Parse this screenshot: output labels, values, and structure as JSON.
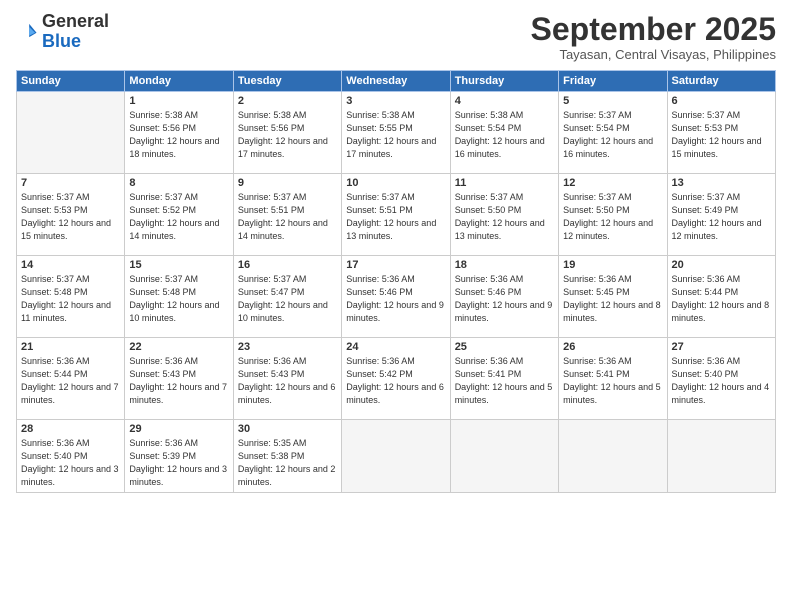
{
  "header": {
    "logo_general": "General",
    "logo_blue": "Blue",
    "month_title": "September 2025",
    "location": "Tayasan, Central Visayas, Philippines"
  },
  "days_of_week": [
    "Sunday",
    "Monday",
    "Tuesday",
    "Wednesday",
    "Thursday",
    "Friday",
    "Saturday"
  ],
  "weeks": [
    [
      {
        "day": "",
        "empty": true
      },
      {
        "day": "1",
        "sunrise": "5:38 AM",
        "sunset": "5:56 PM",
        "daylight": "12 hours and 18 minutes."
      },
      {
        "day": "2",
        "sunrise": "5:38 AM",
        "sunset": "5:56 PM",
        "daylight": "12 hours and 17 minutes."
      },
      {
        "day": "3",
        "sunrise": "5:38 AM",
        "sunset": "5:55 PM",
        "daylight": "12 hours and 17 minutes."
      },
      {
        "day": "4",
        "sunrise": "5:38 AM",
        "sunset": "5:54 PM",
        "daylight": "12 hours and 16 minutes."
      },
      {
        "day": "5",
        "sunrise": "5:37 AM",
        "sunset": "5:54 PM",
        "daylight": "12 hours and 16 minutes."
      },
      {
        "day": "6",
        "sunrise": "5:37 AM",
        "sunset": "5:53 PM",
        "daylight": "12 hours and 15 minutes."
      }
    ],
    [
      {
        "day": "7",
        "sunrise": "5:37 AM",
        "sunset": "5:53 PM",
        "daylight": "12 hours and 15 minutes."
      },
      {
        "day": "8",
        "sunrise": "5:37 AM",
        "sunset": "5:52 PM",
        "daylight": "12 hours and 14 minutes."
      },
      {
        "day": "9",
        "sunrise": "5:37 AM",
        "sunset": "5:51 PM",
        "daylight": "12 hours and 14 minutes."
      },
      {
        "day": "10",
        "sunrise": "5:37 AM",
        "sunset": "5:51 PM",
        "daylight": "12 hours and 13 minutes."
      },
      {
        "day": "11",
        "sunrise": "5:37 AM",
        "sunset": "5:50 PM",
        "daylight": "12 hours and 13 minutes."
      },
      {
        "day": "12",
        "sunrise": "5:37 AM",
        "sunset": "5:50 PM",
        "daylight": "12 hours and 12 minutes."
      },
      {
        "day": "13",
        "sunrise": "5:37 AM",
        "sunset": "5:49 PM",
        "daylight": "12 hours and 12 minutes."
      }
    ],
    [
      {
        "day": "14",
        "sunrise": "5:37 AM",
        "sunset": "5:48 PM",
        "daylight": "12 hours and 11 minutes."
      },
      {
        "day": "15",
        "sunrise": "5:37 AM",
        "sunset": "5:48 PM",
        "daylight": "12 hours and 10 minutes."
      },
      {
        "day": "16",
        "sunrise": "5:37 AM",
        "sunset": "5:47 PM",
        "daylight": "12 hours and 10 minutes."
      },
      {
        "day": "17",
        "sunrise": "5:36 AM",
        "sunset": "5:46 PM",
        "daylight": "12 hours and 9 minutes."
      },
      {
        "day": "18",
        "sunrise": "5:36 AM",
        "sunset": "5:46 PM",
        "daylight": "12 hours and 9 minutes."
      },
      {
        "day": "19",
        "sunrise": "5:36 AM",
        "sunset": "5:45 PM",
        "daylight": "12 hours and 8 minutes."
      },
      {
        "day": "20",
        "sunrise": "5:36 AM",
        "sunset": "5:44 PM",
        "daylight": "12 hours and 8 minutes."
      }
    ],
    [
      {
        "day": "21",
        "sunrise": "5:36 AM",
        "sunset": "5:44 PM",
        "daylight": "12 hours and 7 minutes."
      },
      {
        "day": "22",
        "sunrise": "5:36 AM",
        "sunset": "5:43 PM",
        "daylight": "12 hours and 7 minutes."
      },
      {
        "day": "23",
        "sunrise": "5:36 AM",
        "sunset": "5:43 PM",
        "daylight": "12 hours and 6 minutes."
      },
      {
        "day": "24",
        "sunrise": "5:36 AM",
        "sunset": "5:42 PM",
        "daylight": "12 hours and 6 minutes."
      },
      {
        "day": "25",
        "sunrise": "5:36 AM",
        "sunset": "5:41 PM",
        "daylight": "12 hours and 5 minutes."
      },
      {
        "day": "26",
        "sunrise": "5:36 AM",
        "sunset": "5:41 PM",
        "daylight": "12 hours and 5 minutes."
      },
      {
        "day": "27",
        "sunrise": "5:36 AM",
        "sunset": "5:40 PM",
        "daylight": "12 hours and 4 minutes."
      }
    ],
    [
      {
        "day": "28",
        "sunrise": "5:36 AM",
        "sunset": "5:40 PM",
        "daylight": "12 hours and 3 minutes."
      },
      {
        "day": "29",
        "sunrise": "5:36 AM",
        "sunset": "5:39 PM",
        "daylight": "12 hours and 3 minutes."
      },
      {
        "day": "30",
        "sunrise": "5:35 AM",
        "sunset": "5:38 PM",
        "daylight": "12 hours and 2 minutes."
      },
      {
        "day": "",
        "empty": true
      },
      {
        "day": "",
        "empty": true
      },
      {
        "day": "",
        "empty": true
      },
      {
        "day": "",
        "empty": true
      }
    ]
  ]
}
